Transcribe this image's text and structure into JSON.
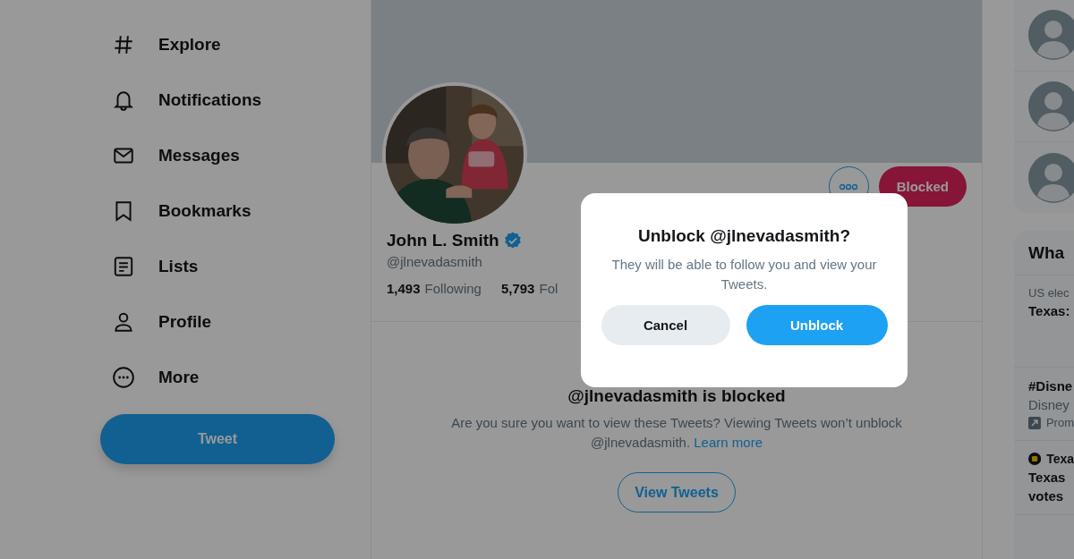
{
  "nav": {
    "items": [
      {
        "kind": "explore",
        "label": "Explore"
      },
      {
        "kind": "notifications",
        "label": "Notifications"
      },
      {
        "kind": "messages",
        "label": "Messages"
      },
      {
        "kind": "bookmarks",
        "label": "Bookmarks"
      },
      {
        "kind": "lists",
        "label": "Lists"
      },
      {
        "kind": "profile",
        "label": "Profile"
      },
      {
        "kind": "more",
        "label": "More"
      }
    ],
    "tweet_button": "Tweet"
  },
  "profile": {
    "name": "John L. Smith",
    "verified": true,
    "handle": "@jlnevadasmith",
    "stats": [
      {
        "count": "1,493",
        "label": "Following"
      },
      {
        "count": "5,793",
        "label": "Fol"
      }
    ],
    "blocked_button": "Blocked"
  },
  "blocked_notice": {
    "title": "@jlnevadasmith is blocked",
    "text": "Are you sure you want to view these Tweets? Viewing Tweets won’t unblock @jlnevadasmith.",
    "link": "Learn more",
    "button": "View Tweets"
  },
  "sidebar": {
    "suggestions": [
      {
        "kind": "avatar"
      },
      {
        "kind": "avatar"
      },
      {
        "kind": "avatar"
      }
    ],
    "trends_title": "Wha",
    "trends": [
      {
        "context": "US elec",
        "lines": [
          "Texas:"
        ]
      },
      {
        "lines": [
          "#Disne"
        ],
        "context": "Disney",
        "promoted": "Prom"
      },
      {
        "source": "Texa",
        "lines": [
          "Texas",
          "votes"
        ]
      }
    ]
  },
  "dialog": {
    "title": "Unblock @jlnevadasmith?",
    "text": "They will be able to follow you and view your Tweets.",
    "cancel": "Cancel",
    "confirm": "Unblock"
  }
}
